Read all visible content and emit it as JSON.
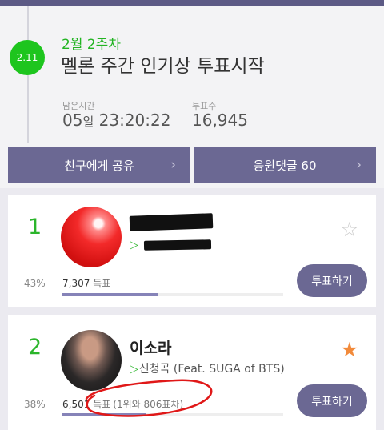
{
  "header": {
    "date_badge": "2.11",
    "week": "2월 2주차",
    "title": "멜론 주간 인기상 투표시작",
    "time_left_label": "남은시간",
    "time_left_days": "05",
    "time_left_day_unit": "일",
    "time_left_clock": "23:20:22",
    "vote_count_label": "투표수",
    "vote_count": "16,945"
  },
  "actions": {
    "share_label": "친구에게 공유",
    "comment_label": "응원댓글 60",
    "chevron": "›"
  },
  "candidates": [
    {
      "rank": "1",
      "artist": "",
      "song": "",
      "percent": "43%",
      "votes": "7,307",
      "votes_unit": "득표",
      "vote_share": 0.43,
      "favorite": false,
      "vote_button_label": "투표하기",
      "star_icon": "star-outline-icon"
    },
    {
      "rank": "2",
      "artist": "이소라",
      "song": "신청곡 (Feat. SUGA of BTS)",
      "percent": "38%",
      "votes": "6,501",
      "votes_unit": "득표",
      "vote_diff": "(1위와 806표차)",
      "vote_share": 0.38,
      "favorite": true,
      "vote_button_label": "투표하기",
      "star_icon": "star-filled-icon"
    }
  ],
  "colors": {
    "accent_green": "#1ec51e",
    "button_purple": "#6b6893",
    "bar_purple": "#8683b8",
    "star_orange": "#f28a3a",
    "annotation_red": "#e01818"
  }
}
